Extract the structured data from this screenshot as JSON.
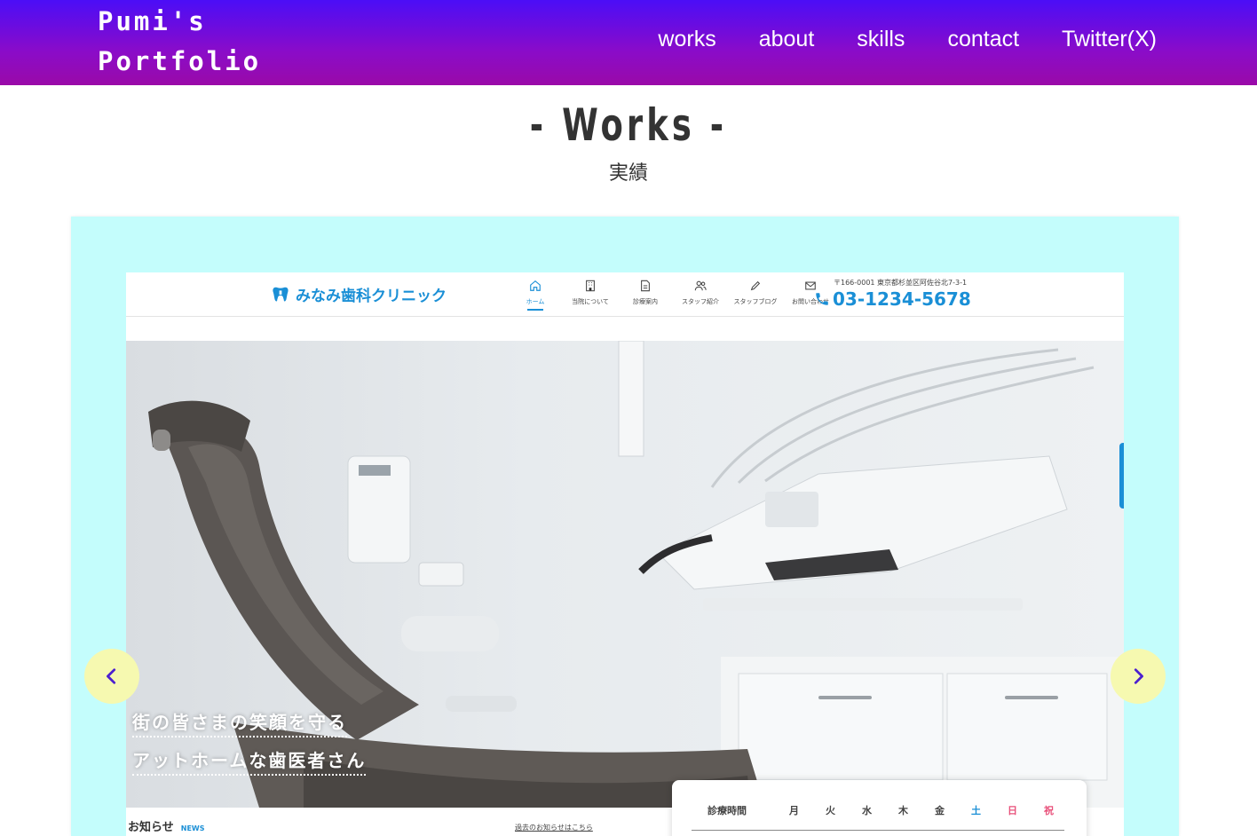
{
  "header": {
    "logo_line1": "Pumi's",
    "logo_line2": "Portfolio",
    "nav": [
      "works",
      "about",
      "skills",
      "contact",
      "Twitter(X)"
    ]
  },
  "section": {
    "title": "- Works -",
    "subtitle": "実績"
  },
  "slide": {
    "site_name": "みなみ歯科クリニック",
    "nav": [
      "ホーム",
      "当院について",
      "診療案内",
      "スタッフ紹介",
      "スタッフブログ",
      "お問い合わせ"
    ],
    "address": "〒166-0001 東京都杉並区阿佐谷北7-3-1",
    "phone": "03-1234-5678",
    "catch_line1": "街の皆さまの笑顔を守る",
    "catch_line2": "アットホームな歯医者さん",
    "news_title": "お知らせ",
    "news_en": "NEWS",
    "past_news_link": "過去のお知らせはこちら",
    "hours_title": "診療時間",
    "days": [
      "月",
      "火",
      "水",
      "木",
      "金",
      "土",
      "日",
      "祝"
    ]
  },
  "colors": {
    "header_gradient_top": "#4b0df7",
    "header_gradient_bottom": "#9a0aa8",
    "slider_bg": "#c4fdfc",
    "arrow_bg": "#f6f9b0",
    "arrow_icon": "#4b1fd0",
    "clinic_accent": "#1a8fd6"
  },
  "icons": [
    "prev-arrow-icon",
    "next-arrow-icon",
    "home-icon",
    "building-icon",
    "document-icon",
    "staff-icon",
    "pencil-icon",
    "mail-icon",
    "phone-icon",
    "tooth-icon"
  ]
}
